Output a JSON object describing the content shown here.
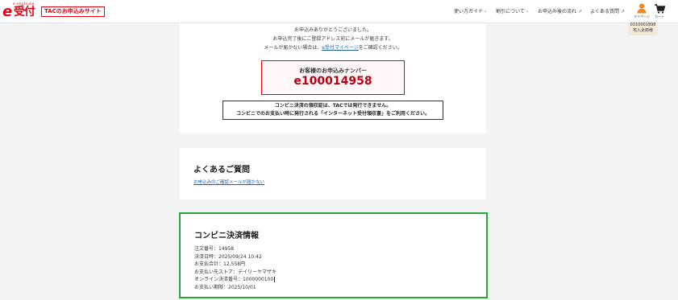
{
  "header": {
    "logo_text": "受付",
    "logo_sub": "e-uketsuke",
    "site_badge": "TACのお申込みサイト",
    "nav": [
      {
        "label": "使い方ガイド",
        "mark": "›"
      },
      {
        "label": "割引について",
        "mark": "›"
      },
      {
        "label": "お申込み後の流れ",
        "mark": "↗"
      },
      {
        "label": "よくある質問",
        "mark": "↗"
      }
    ],
    "mypage_label": "マイページ",
    "cart_label": "カート",
    "member_id": "0310001898",
    "member_name": "宅入太郎様"
  },
  "completion": {
    "line1": "お申込みありがとうございました。",
    "line2": "お申込完了後にご登録アドレス宛にメールが届きます。",
    "line3_before": "メールが届かない場合は、",
    "line3_link": "e受付マイページ",
    "line3_after": "をご確認ください。",
    "number_label": "お客様のお申込みナンバー",
    "number_value": "e100014958",
    "notice_line1": "コンビニ決済の領収証は、TACでは発行できません。",
    "notice_line2": "コンビニでのお支払い時に発行される「インターネット受付領収書」をご利用ください。"
  },
  "faq": {
    "title": "よくあるご質問",
    "link": "お申込みのご確認メールが届かない"
  },
  "convenience": {
    "title": "コンビニ決済情報",
    "rows": [
      "注文番号：14958",
      "決済日時：2025/09/24 10:42",
      "お支払合計：12,558円",
      "お支払い先ストア：デイリーヤマザキ",
      "オンライン決済番号：1000000100",
      "お支払い期限：2025/10/01"
    ]
  },
  "colors": {
    "brand_red": "#e60012",
    "highlight_green": "#27a53a",
    "link_blue": "#1a5fb4"
  }
}
